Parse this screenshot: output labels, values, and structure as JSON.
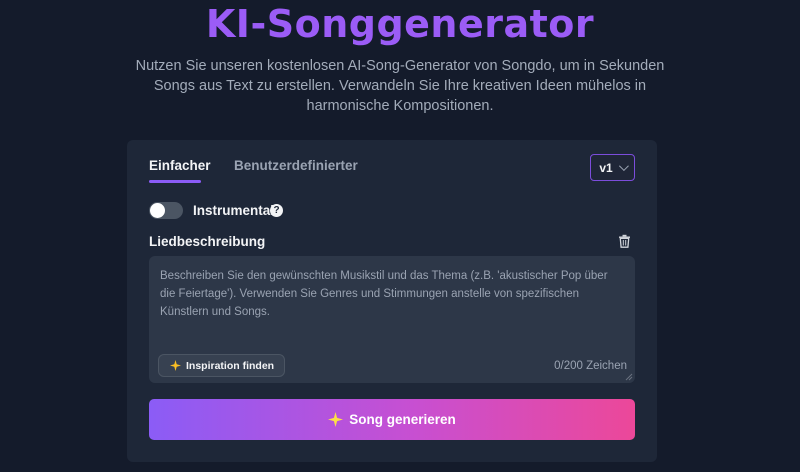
{
  "header": {
    "title": "KI-Songgenerator",
    "subtitle": "Nutzen Sie unseren kostenlosen AI-Song-Generator von Songdo, um in Sekunden Songs aus Text zu erstellen. Verwandeln Sie Ihre kreativen Ideen mühelos in harmonische Kompositionen."
  },
  "tabs": [
    {
      "label": "Einfacher",
      "active": true
    },
    {
      "label": "Benutzerdefinierter",
      "active": false
    }
  ],
  "version_select": {
    "value": "v1"
  },
  "instrumental": {
    "label": "Instrumental",
    "enabled": false
  },
  "description": {
    "label": "Liedbeschreibung",
    "value": "",
    "placeholder": "Beschreiben Sie den gewünschten Musikstil und das Thema (z.B. 'akustischer Pop über die Feiertage'). Verwenden Sie Genres und Stimmungen anstelle von spezifischen Künstlern und Songs.",
    "counter": "0/200 Zeichen",
    "inspiration_label": "Inspiration finden"
  },
  "generate_button": {
    "label": "Song generieren"
  },
  "icons": {
    "help": "question-circle-icon",
    "trash": "trash-icon",
    "sparkle": "sparkle-icon",
    "chevron": "chevron-down-icon"
  },
  "colors": {
    "accent": "#8b5cf6",
    "gradient_start": "#8b5cf6",
    "gradient_end": "#ec4899",
    "background": "#141b2b",
    "card": "#1e2738"
  }
}
